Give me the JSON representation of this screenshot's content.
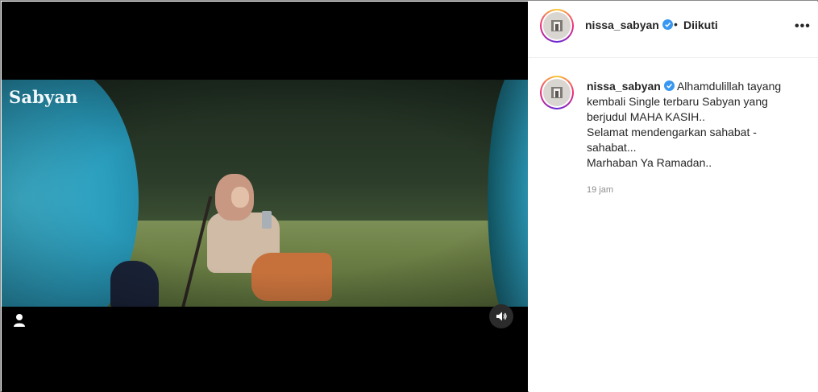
{
  "video": {
    "watermark": "Sabyan"
  },
  "header": {
    "username": "nissa_sabyan",
    "separator": "•",
    "follow_status": "Diikuti",
    "more_label": "•••"
  },
  "caption": {
    "username": "nissa_sabyan",
    "first_line": "Alhamdulillah tayang",
    "lines": [
      "kembali Single terbaru Sabyan yang",
      "berjudul MAHA KASIH..",
      "Selamat mendengarkan sahabat -",
      "sahabat...",
      "Marhaban Ya Ramadan.."
    ],
    "timestamp": "19 jam"
  },
  "colors": {
    "verified": "#3897f0",
    "text": "#262626",
    "muted": "#8e8e8e"
  },
  "icons": {
    "user_tag": "user-icon",
    "sound": "speaker-icon",
    "verified": "verified-badge-icon",
    "more": "more-options-icon"
  }
}
